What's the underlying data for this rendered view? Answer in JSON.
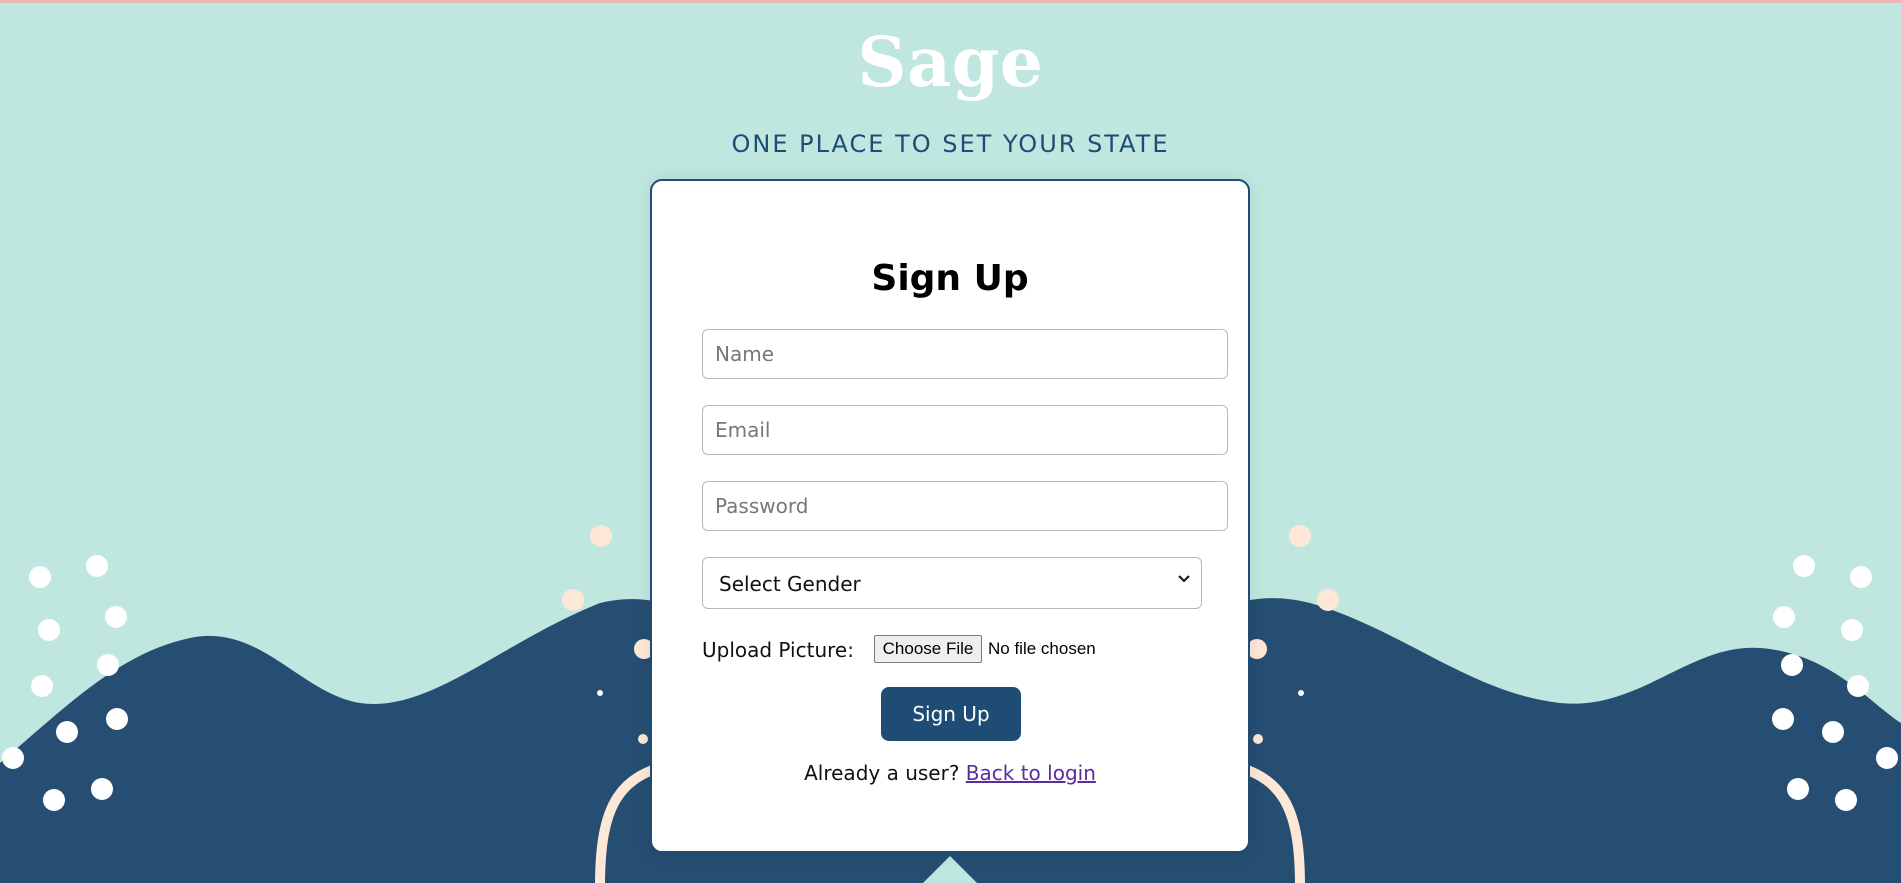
{
  "brand": {
    "name": "Sage",
    "tagline": "ONE PLACE TO SET YOUR STATE"
  },
  "signup": {
    "title": "Sign Up",
    "name_placeholder": "Name",
    "email_placeholder": "Email",
    "password_placeholder": "Password",
    "gender_selected": "Select Gender",
    "upload_label": "Upload Picture:",
    "file_button": "Choose File",
    "file_status": "No file chosen",
    "submit_label": "Sign Up",
    "already_user_text": "Already a user?",
    "login_link": "Back to login"
  },
  "colors": {
    "background": "#bfe7df",
    "navy": "#1f4c74",
    "card": "#ffffff",
    "accent_peach": "#fde7d6",
    "link": "#5a2ca0"
  },
  "icons": {
    "select_chevron": "chevron-down-icon"
  }
}
